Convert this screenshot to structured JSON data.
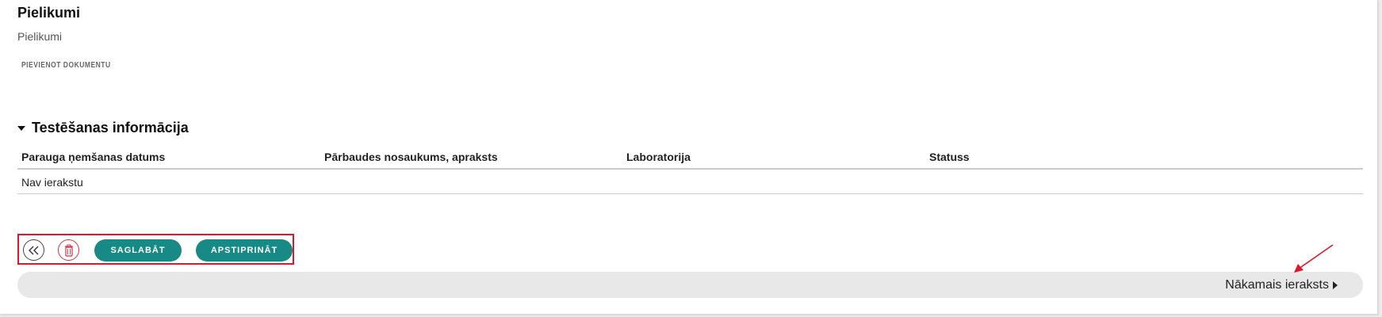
{
  "attachments": {
    "title": "Pielikumi",
    "subtitle": "Pielikumi",
    "add_document_label": "PIEVIENOT DOKUMENTU"
  },
  "testing": {
    "title": "Testēšanas informācija",
    "columns": [
      "Parauga ņemšanas datums",
      "Pārbaudes nosaukums, apraksts",
      "Laboratorija",
      "Statuss"
    ],
    "empty_text": "Nav ierakstu"
  },
  "actions": {
    "back_icon": "double-chevron-left-icon",
    "delete_icon": "trash-icon",
    "save_label": "SAGLABĀT",
    "confirm_label": "APSTIPRINĀT"
  },
  "navigation": {
    "next_label": "Nākamais ieraksts",
    "next_icon": "caret-right-icon"
  },
  "colors": {
    "primary_button": "#178a85",
    "delete_accent": "#d4354a",
    "highlight_annotation": "#e0162b"
  }
}
